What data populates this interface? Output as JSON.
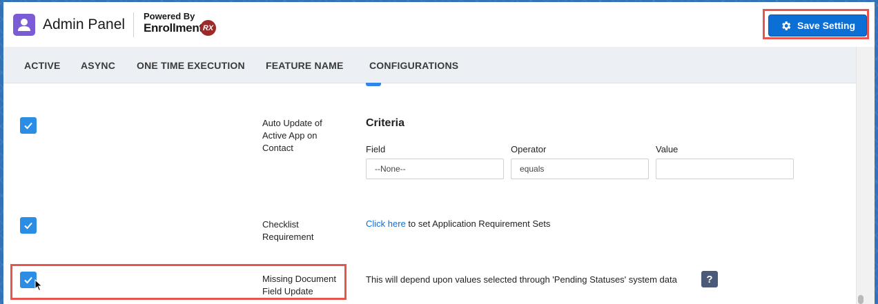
{
  "header": {
    "title": "Admin Panel",
    "powered_by": "Powered By",
    "brand": "Enrollment",
    "brand_mark": "RX",
    "save_label": "Save Setting"
  },
  "columns": [
    "ACTIVE",
    "ASYNC",
    "ONE TIME EXECUTION",
    "FEATURE NAME",
    "CONFIGURATIONS"
  ],
  "rows": [
    {
      "active": true,
      "feature": "Auto Update of Active App on Contact",
      "criteria": {
        "title": "Criteria",
        "field_label": "Field",
        "operator_label": "Operator",
        "value_label": "Value",
        "field_value": "--None--",
        "operator_value": "equals",
        "value_value": ""
      }
    },
    {
      "active": true,
      "feature": "Checklist Requirement",
      "link_text": "Click here",
      "link_suffix": " to set Application Requirement Sets"
    },
    {
      "active": true,
      "feature": "Missing Document Field Update",
      "description": "This will depend upon values selected through 'Pending Statuses' system data",
      "help_icon": "?"
    }
  ],
  "colors": {
    "accent": "#0b6fd6",
    "checkbox": "#2b8de4",
    "highlight": "#e8554e",
    "app_icon": "#7b5bd6"
  }
}
